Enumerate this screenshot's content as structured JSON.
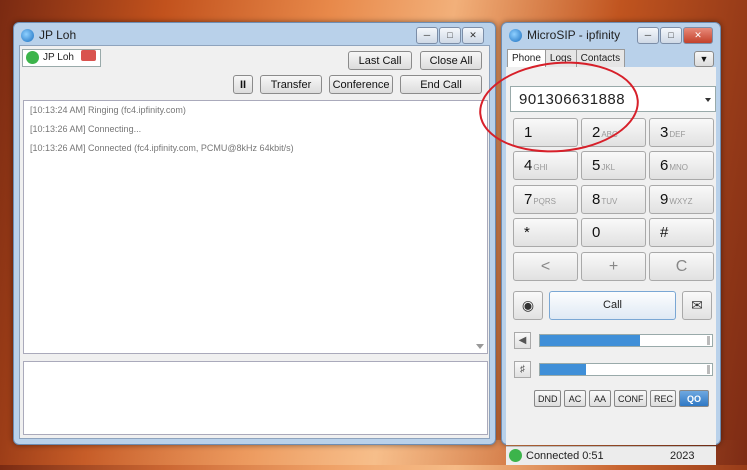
{
  "call_window": {
    "title": "JP Loh",
    "tab_label": "JP Loh",
    "last_call_label": "Last Call",
    "close_all_label": "Close All",
    "pause_label": "II",
    "transfer_label": "Transfer",
    "conference_label": "Conference",
    "end_call_label": "End Call",
    "log": [
      "[10:13:24 AM]  Ringing (fc4.ipfinity.com)",
      "[10:13:26 AM]  Connecting...",
      "[10:13:26 AM]  Connected (fc4.ipfinity.com, PCMU@8kHz 64kbit/s)"
    ]
  },
  "microsip": {
    "title": "MicroSIP - ipfinity",
    "tabs": [
      "Phone",
      "Logs",
      "Contacts"
    ],
    "dial_number": "901306631888",
    "keys": [
      {
        "digit": "1",
        "letters": ""
      },
      {
        "digit": "2",
        "letters": "ABC"
      },
      {
        "digit": "3",
        "letters": "DEF"
      },
      {
        "digit": "4",
        "letters": "GHI"
      },
      {
        "digit": "5",
        "letters": "JKL"
      },
      {
        "digit": "6",
        "letters": "MNO"
      },
      {
        "digit": "7",
        "letters": "PQRS"
      },
      {
        "digit": "8",
        "letters": "TUV"
      },
      {
        "digit": "9",
        "letters": "WXYZ"
      },
      {
        "digit": "*",
        "letters": ""
      },
      {
        "digit": "0",
        "letters": ""
      },
      {
        "digit": "#",
        "letters": ""
      }
    ],
    "nav_keys": [
      "<",
      "+",
      "C"
    ],
    "call_label": "Call",
    "speaker_volume": 0.58,
    "mic_volume": 0.27,
    "features": [
      "DND",
      "AC",
      "AA",
      "CONF",
      "REC",
      "QO"
    ],
    "status_text": "Connected 0:51",
    "status_year": "2023"
  },
  "colors": {
    "annotation": "#d7202a",
    "volume_fill": "#3f8fd8",
    "presence": "#3cb44b"
  }
}
